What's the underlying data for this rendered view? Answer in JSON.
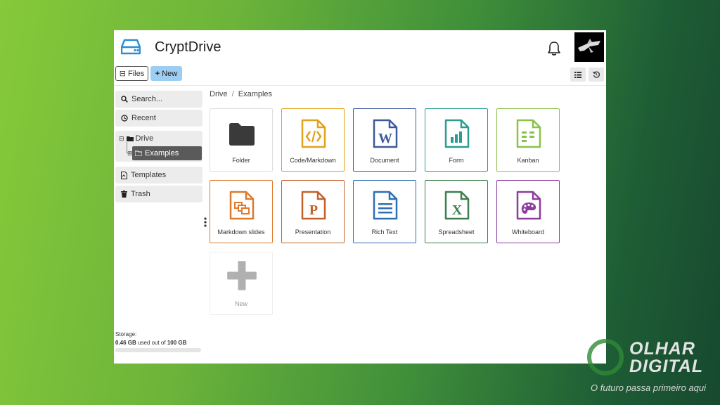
{
  "app": {
    "title": "CryptDrive"
  },
  "toolbar": {
    "files_label": "Files",
    "new_label": "New"
  },
  "sidebar": {
    "search_label": "Search...",
    "recent_label": "Recent",
    "drive_label": "Drive",
    "examples_label": "Examples",
    "templates_label": "Templates",
    "trash_label": "Trash"
  },
  "storage": {
    "label": "Storage:",
    "used": "0.46 GB",
    "middle": " used out of ",
    "total": "100 GB",
    "fraction_used": 0.0046
  },
  "breadcrumb": {
    "root": "Drive",
    "sep": "/",
    "current": "Examples"
  },
  "tiles": {
    "folder": "Folder",
    "code": "Code/Markdown",
    "document": "Document",
    "form": "Form",
    "kanban": "Kanban",
    "slides": "Markdown slides",
    "presentation": "Presentation",
    "richtext": "Rich Text",
    "spreadsheet": "Spreadsheet",
    "whiteboard": "Whiteboard",
    "new": "New"
  },
  "colors": {
    "folder": "#3a3a3a",
    "code": "#e2a21a",
    "document": "#3d5a9e",
    "form": "#2a9d8f",
    "kanban": "#8bc34a",
    "slides": "#e07a2b",
    "presentation": "#c2622a",
    "richtext": "#2f6fb3",
    "spreadsheet": "#3f7f4f",
    "whiteboard": "#8e3c9e",
    "new": "#b0b0b0",
    "new_button": "#9ecdf2"
  },
  "watermark": {
    "title_line1": "OLHAR",
    "title_line2": "DIGITAL",
    "tagline": "O futuro passa primeiro aqui"
  }
}
